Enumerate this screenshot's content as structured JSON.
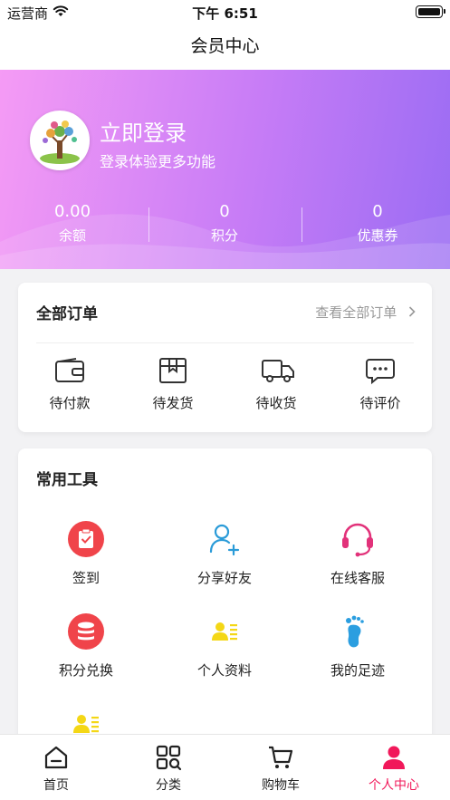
{
  "status_bar": {
    "carrier": "运营商",
    "time": "下午 6:51"
  },
  "nav": {
    "title": "会员中心"
  },
  "profile": {
    "login_title": "立即登录",
    "login_subtitle": "登录体验更多功能",
    "stats": [
      {
        "value": "0.00",
        "label": "余额"
      },
      {
        "value": "0",
        "label": "积分"
      },
      {
        "value": "0",
        "label": "优惠券"
      }
    ]
  },
  "orders": {
    "title": "全部订单",
    "view_all": "查看全部订单",
    "items": [
      {
        "label": "待付款",
        "icon": "wallet-icon"
      },
      {
        "label": "待发货",
        "icon": "package-icon"
      },
      {
        "label": "待收货",
        "icon": "truck-icon"
      },
      {
        "label": "待评价",
        "icon": "comment-icon"
      }
    ]
  },
  "tools": {
    "title": "常用工具",
    "items": [
      {
        "label": "签到",
        "icon": "checkin-icon"
      },
      {
        "label": "分享好友",
        "icon": "share-user-icon"
      },
      {
        "label": "在线客服",
        "icon": "headset-icon"
      },
      {
        "label": "积分兑换",
        "icon": "coins-icon"
      },
      {
        "label": "个人资料",
        "icon": "profile-card-icon"
      },
      {
        "label": "我的足迹",
        "icon": "footprint-icon"
      },
      {
        "label": "",
        "icon": "profile-card-icon"
      }
    ]
  },
  "tab_bar": {
    "items": [
      {
        "label": "首页",
        "icon": "home-icon"
      },
      {
        "label": "分类",
        "icon": "category-icon"
      },
      {
        "label": "购物车",
        "icon": "cart-icon"
      },
      {
        "label": "个人中心",
        "icon": "user-icon"
      }
    ],
    "active_index": 3
  },
  "colors": {
    "accent": "#f1185a",
    "header_gradient_start": "#f59bf5",
    "header_gradient_end": "#9a6cf3",
    "checkin_red": "#f0444a",
    "share_blue": "#2a9bd8",
    "headset_pink": "#e2327a",
    "profile_yellow": "#f4d716",
    "footprint_blue": "#2b9ee0"
  }
}
